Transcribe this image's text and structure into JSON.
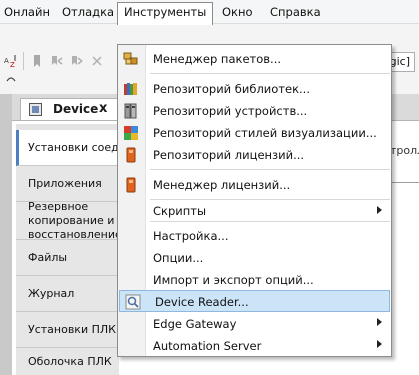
{
  "menubar": {
    "items": [
      {
        "label": "Онлайн"
      },
      {
        "label": "Отладка"
      },
      {
        "label": "Инструменты"
      },
      {
        "label": "Окно"
      },
      {
        "label": "Справка"
      }
    ]
  },
  "toolbar": {
    "combo_tail": "egic]"
  },
  "document_tab": {
    "label": "Device",
    "close_label": "x"
  },
  "device_nav": {
    "items": [
      {
        "label": "Установки соединения"
      },
      {
        "label": "Приложения"
      },
      {
        "label": "Резервное копирование и восстановление"
      },
      {
        "label": "Файлы"
      },
      {
        "label": "Журнал"
      },
      {
        "label": "Установки ПЛК"
      },
      {
        "label": "Оболочка ПЛК"
      }
    ]
  },
  "right_hint": "троллер",
  "tools_menu": {
    "items": [
      {
        "label": "Менеджер пакетов...",
        "icon": "package-manager-icon"
      },
      {
        "label": "Репозиторий библиотек...",
        "icon": "library-repository-icon"
      },
      {
        "label": "Репозиторий устройств...",
        "icon": "device-repository-icon"
      },
      {
        "label": "Репозиторий стилей визуализации...",
        "icon": "visualization-styles-icon"
      },
      {
        "label": "Репозиторий лицензий...",
        "icon": "license-repository-icon"
      },
      {
        "label": "Менеджер лицензий...",
        "icon": "license-manager-icon"
      },
      {
        "label": "Скрипты",
        "submenu": true
      },
      {
        "label": "Настройка..."
      },
      {
        "label": "Опции..."
      },
      {
        "label": "Импорт и экспорт опций..."
      },
      {
        "label": "Device Reader...",
        "icon": "device-reader-icon",
        "highlighted": true
      },
      {
        "label": "Edge Gateway",
        "submenu": true
      },
      {
        "label": "Automation Server",
        "submenu": true
      }
    ]
  }
}
